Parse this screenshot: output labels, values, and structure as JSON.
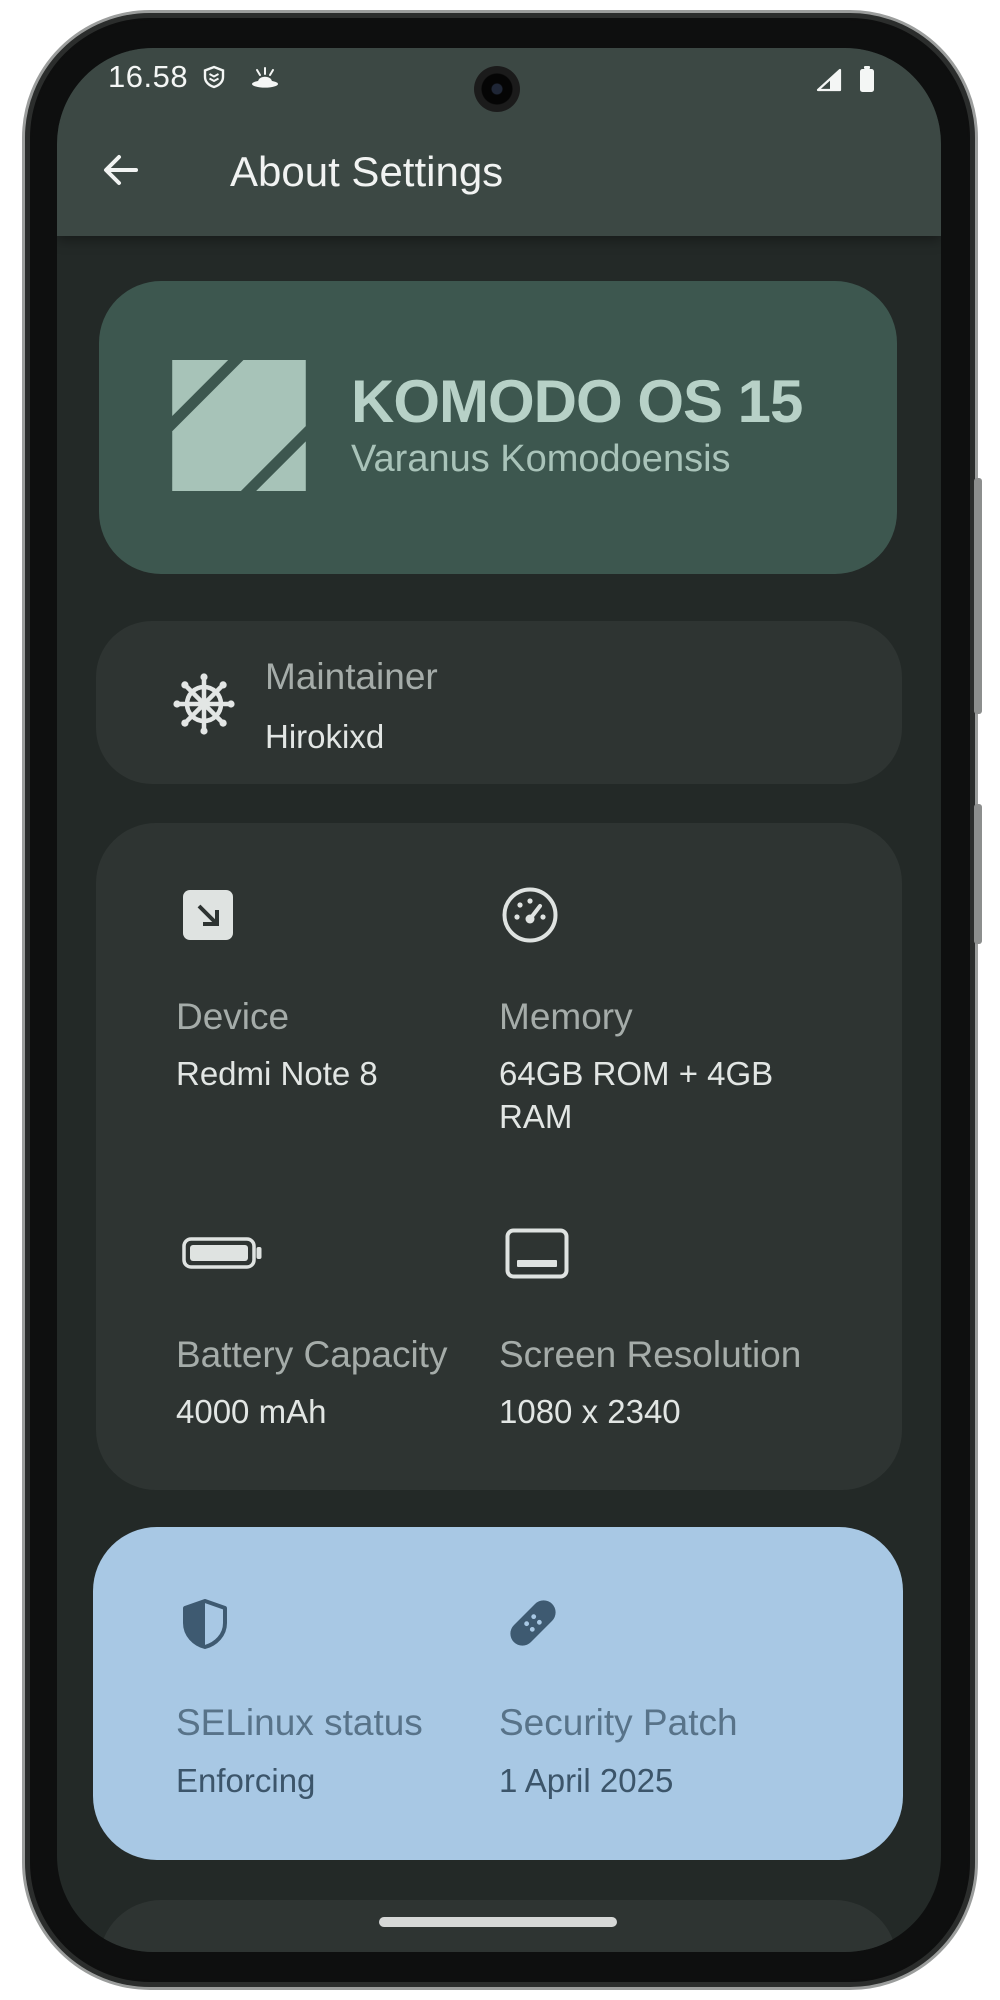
{
  "status_bar": {
    "time": "16.58",
    "left_icons": [
      "shield-stack-icon",
      "ufo-icon"
    ],
    "right_icons": [
      "signal-icon",
      "battery-status-icon"
    ]
  },
  "app_bar": {
    "back_icon": "arrow-back-icon",
    "title": "About Settings"
  },
  "banner": {
    "logo": "komodo-logo",
    "os_name": "KOMODO OS 15",
    "codename": "Varanus Komodoensis"
  },
  "maintainer": {
    "icon": "ship-wheel-icon",
    "label": "Maintainer",
    "value": "Hirokixd"
  },
  "device_info": [
    {
      "icon": "device-icon",
      "label": "Device",
      "value": "Redmi Note 8"
    },
    {
      "icon": "gauge-icon",
      "label": "Memory",
      "value": "64GB ROM + 4GB RAM"
    },
    {
      "icon": "battery-icon",
      "label": "Battery Capacity",
      "value": "4000 mAh"
    },
    {
      "icon": "screen-icon",
      "label": "Screen Resolution",
      "value": "1080 x 2340"
    }
  ],
  "security": [
    {
      "icon": "shield-icon",
      "label": "SELinux status",
      "value": "Enforcing"
    },
    {
      "icon": "bandage-icon",
      "label": "Security Patch",
      "value": "1 April 2025"
    }
  ],
  "colors": {
    "screen_background": "#232927",
    "header_background": "#3c4844",
    "banner_card": "#3d574f",
    "card": "#2e3432",
    "security_card": "#a8c8e4"
  }
}
